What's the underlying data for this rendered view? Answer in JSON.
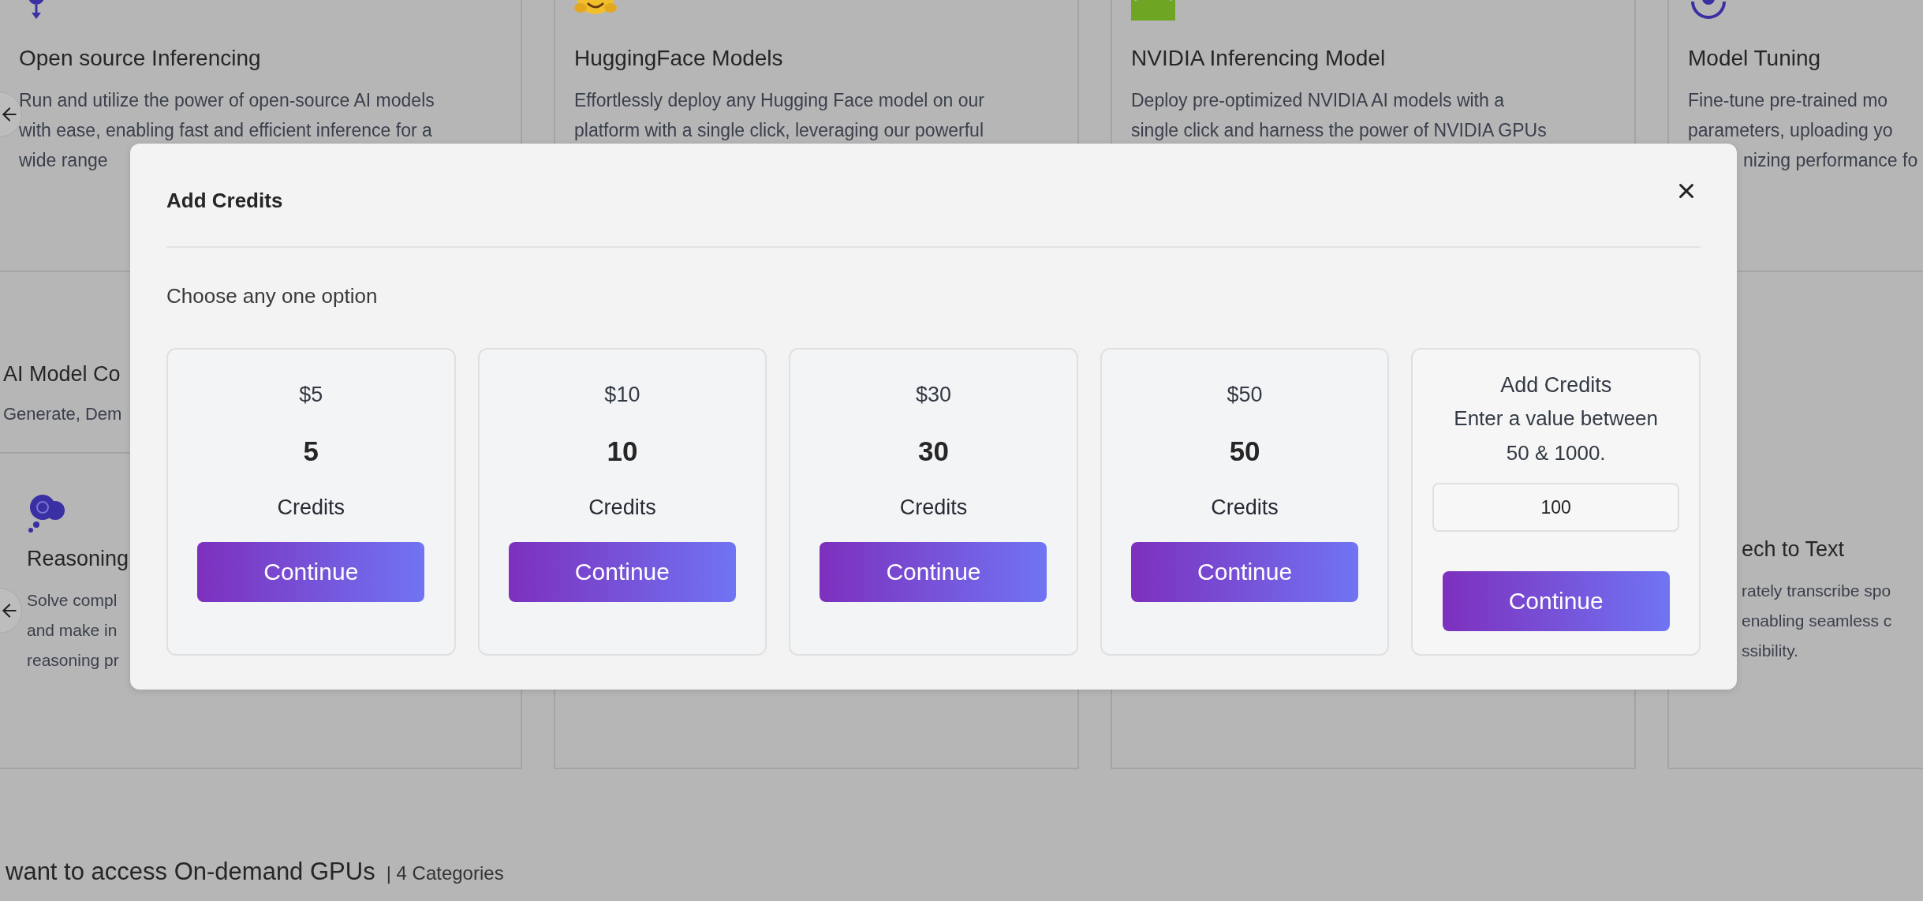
{
  "top_cards": [
    {
      "title": "Open source Inferencing",
      "lines": [
        "Run and utilize the power of open-source AI models",
        "with ease, enabling fast and efficient inference for a",
        "wide range"
      ]
    },
    {
      "title": "HuggingFace Models",
      "lines": [
        "Effortlessly deploy any Hugging Face model on our",
        "platform with a single click, leveraging our powerful"
      ]
    },
    {
      "title": "NVIDIA Inferencing Model",
      "lines": [
        "Deploy pre-optimized NVIDIA AI models with a",
        "single click and harness the power of NVIDIA GPUs"
      ]
    },
    {
      "title": "Model Tuning",
      "lines": [
        "Fine-tune pre-trained mo",
        "parameters, uploading yo"
      ],
      "partly_covered_line": "nizing performance fo"
    }
  ],
  "middle_section": {
    "title": "AI Model Co",
    "description": "Generate, Dem"
  },
  "bottom_cards": [
    {
      "title": "Reasoning",
      "lines": [
        "Solve compl",
        "and make in",
        "reasoning pr"
      ]
    },
    {
      "title": "ech to Text",
      "lines": [
        "rately transcribe spo",
        "enabling seamless c",
        "ssibility."
      ]
    }
  ],
  "section_heading": {
    "title": "want to access On-demand GPUs",
    "count": "| 4 Categories"
  },
  "modal": {
    "title": "Add Credits",
    "subtitle": "Choose any one option",
    "options": [
      {
        "kind": "preset",
        "price": "$5",
        "credits": "5",
        "unit": "Credits",
        "button": "Continue"
      },
      {
        "kind": "preset",
        "price": "$10",
        "credits": "10",
        "unit": "Credits",
        "button": "Continue"
      },
      {
        "kind": "preset",
        "price": "$30",
        "credits": "30",
        "unit": "Credits",
        "button": "Continue"
      },
      {
        "kind": "preset",
        "price": "$50",
        "credits": "50",
        "unit": "Credits",
        "button": "Continue"
      },
      {
        "kind": "custom",
        "title": "Add Credits",
        "hint": "Enter a value between 50 & 1000.",
        "value": "100",
        "button": "Continue"
      }
    ]
  }
}
